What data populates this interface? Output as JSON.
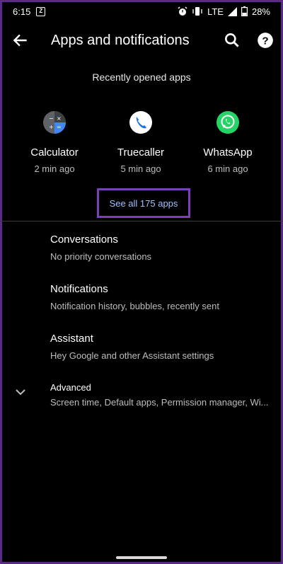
{
  "status_bar": {
    "time": "6:15",
    "network": "LTE",
    "battery": "28%",
    "icons": [
      "screenshot-icon",
      "alarm-icon",
      "vibrate-icon",
      "signal-icon",
      "battery-icon"
    ]
  },
  "app_bar": {
    "title": "Apps and notifications",
    "icons": [
      "back-arrow-icon",
      "search-icon",
      "help-icon"
    ]
  },
  "recent": {
    "heading": "Recently opened apps",
    "apps": [
      {
        "name": "Calculator",
        "time": "2 min ago",
        "icon": "calculator-icon"
      },
      {
        "name": "Truecaller",
        "time": "5 min ago",
        "icon": "truecaller-icon"
      },
      {
        "name": "WhatsApp",
        "time": "6 min ago",
        "icon": "whatsapp-icon"
      }
    ],
    "see_all": "See all 175 apps"
  },
  "settings": [
    {
      "title": "Conversations",
      "subtitle": "No priority conversations"
    },
    {
      "title": "Notifications",
      "subtitle": "Notification history, bubbles, recently sent"
    },
    {
      "title": "Assistant",
      "subtitle": "Hey Google and other Assistant settings"
    },
    {
      "title": "Advanced",
      "subtitle": "Screen time, Default apps, Permission manager, Wi..."
    }
  ],
  "colors": {
    "accent_link": "#9ec1ff",
    "highlight_border": "#7b3fb8",
    "whatsapp_green": "#25d366",
    "truecaller_blue": "#1a73e8"
  }
}
